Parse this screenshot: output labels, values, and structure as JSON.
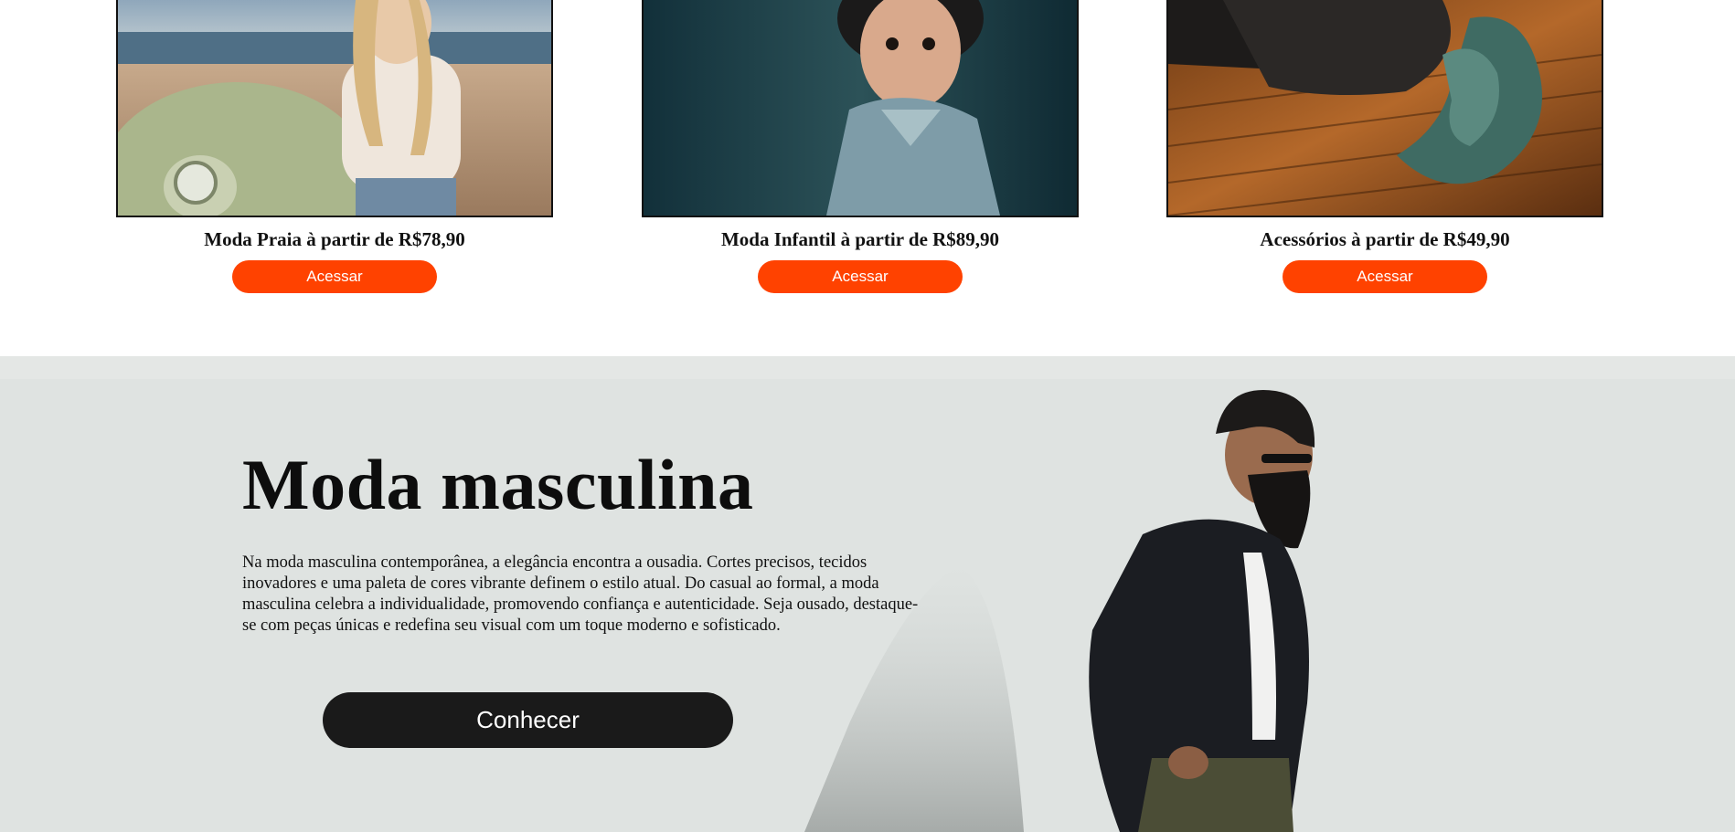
{
  "cards": [
    {
      "title": "Moda Praia à partir de R$78,90",
      "button_label": "Acessar",
      "image": "beach-fashion-photo"
    },
    {
      "title": "Moda Infantil à partir de R$89,90",
      "button_label": "Acessar",
      "image": "kids-fashion-photo"
    },
    {
      "title": "Acessórios à partir de R$49,90",
      "button_label": "Acessar",
      "image": "accessories-photo"
    }
  ],
  "hero": {
    "heading": "Moda masculina",
    "description": "Na moda masculina contemporânea, a elegância encontra a ousadia. Cortes precisos, tecidos inovadores e uma paleta de cores vibrante definem o estilo atual. Do casual ao formal, a moda masculina celebra a individualidade, promovendo confiança e autenticidade. Seja ousado, destaque-se com peças únicas e redefina seu visual com um toque moderno e sofisticado.",
    "button_label": "Conhecer",
    "image": "mens-fashion-model-photo"
  },
  "colors": {
    "accent": "#ff4200",
    "dark_button": "#1a1a1a",
    "hero_background": "#dfe3e1"
  }
}
